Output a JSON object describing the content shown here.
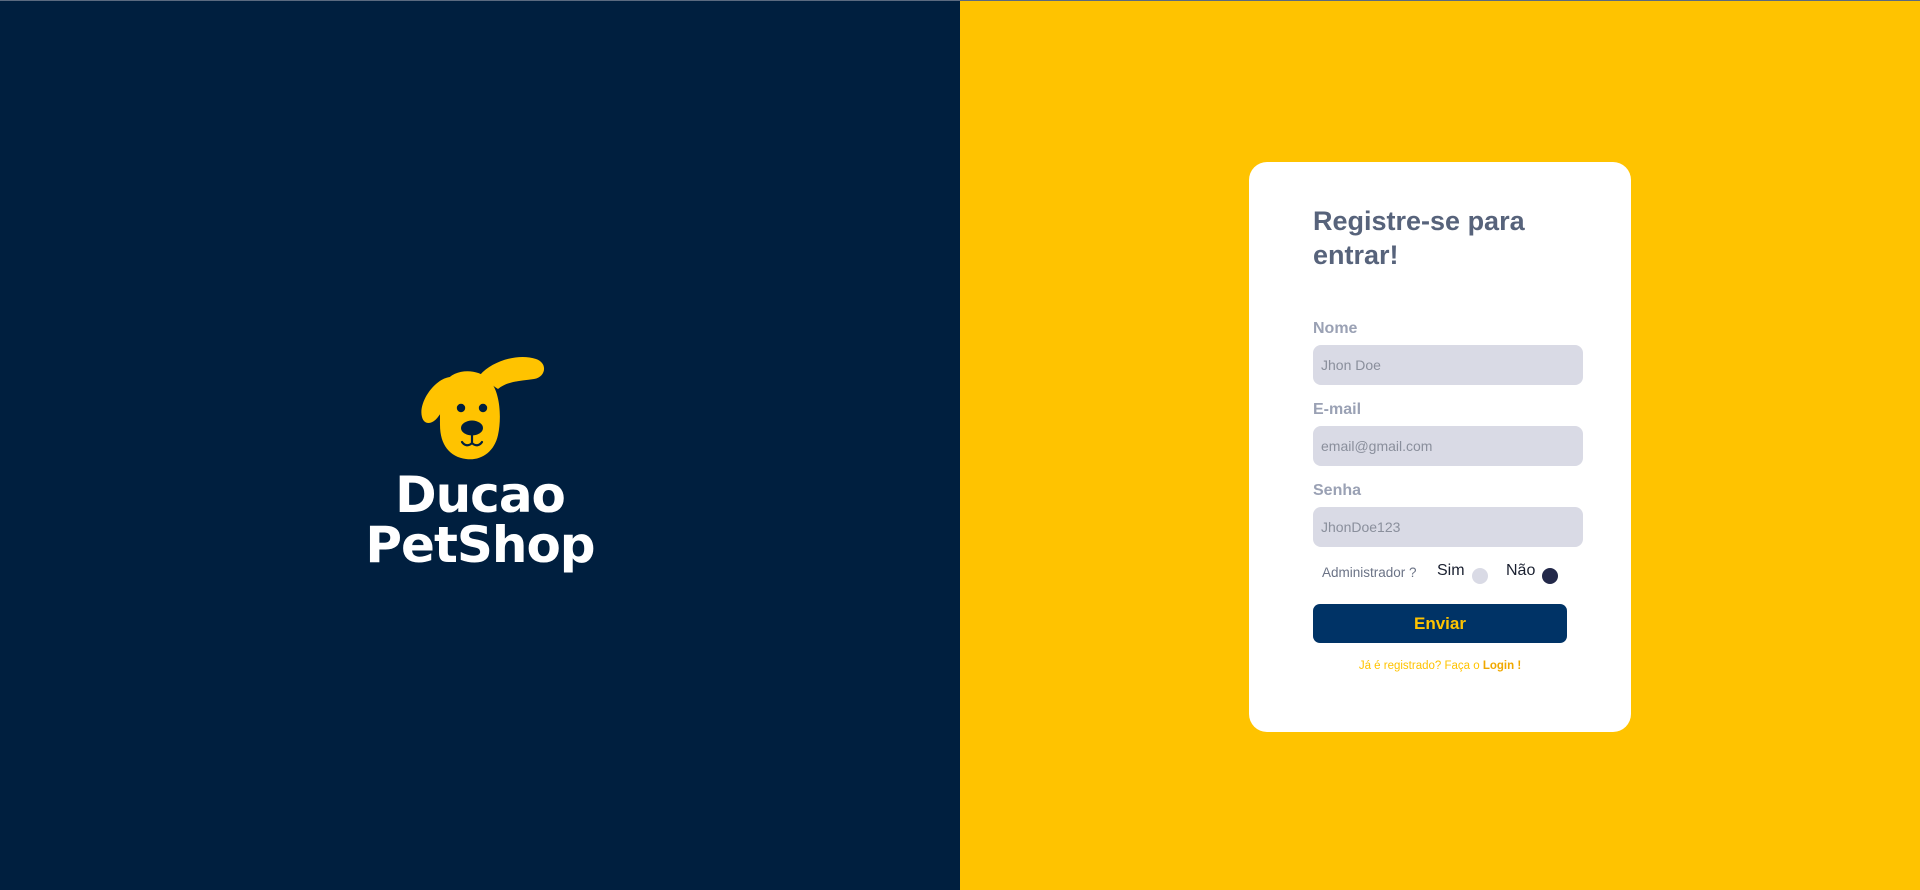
{
  "brand": {
    "name": "Ducao PetShop",
    "logo_icon": "dog-face-icon"
  },
  "colors": {
    "left_background": "#001f3f",
    "right_background": "#ffc300",
    "accent": "#ffc300",
    "button_background": "#003366"
  },
  "form": {
    "title": "Registre-se para entrar!",
    "fields": [
      {
        "label": "Nome",
        "placeholder": "Jhon Doe",
        "value": ""
      },
      {
        "label": "E-mail",
        "placeholder": "email@gmail.com",
        "value": ""
      },
      {
        "label": "Senha",
        "placeholder": "JhonDoe123",
        "value": ""
      }
    ],
    "admin": {
      "label": "Administrador ?",
      "options": [
        {
          "label": "Sim",
          "selected": false
        },
        {
          "label": "Não",
          "selected": true
        }
      ]
    },
    "submit_label": "Enviar",
    "login_prompt": "Já é registrado? Faça o",
    "login_link": "Login !"
  }
}
